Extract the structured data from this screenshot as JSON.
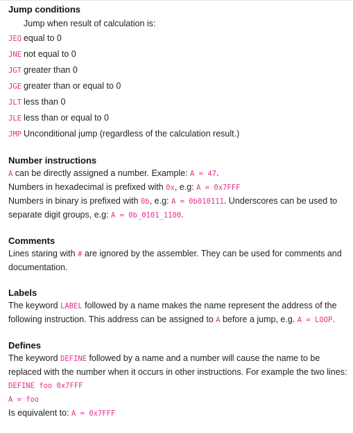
{
  "jump": {
    "title": "Jump conditions",
    "intro": "Jump when result of calculation is:",
    "conditions": [
      {
        "code": "JEQ",
        "desc": "equal to 0"
      },
      {
        "code": "JNE",
        "desc": "not equal to 0"
      },
      {
        "code": "JGT",
        "desc": "greater than 0"
      },
      {
        "code": "JGE",
        "desc": "greater than or equal to 0"
      },
      {
        "code": "JLT",
        "desc": "less than 0"
      },
      {
        "code": "JLE",
        "desc": "less than or equal to 0"
      },
      {
        "code": "JMP",
        "desc": "Unconditional jump (regardless of the calculation result.)"
      }
    ]
  },
  "number": {
    "title": "Number instructions",
    "l1_code1": "A",
    "l1_text1": " can be directly assigned a number. Example: ",
    "l1_code2": "A = 47",
    "l1_text2": ".",
    "l2_text1": "Numbers in hexadecimal is prefixed with ",
    "l2_code1": "0x",
    "l2_text2": ", e.g: ",
    "l2_code2": "A = 0x7FFF",
    "l3_text1": "Numbers in binary is prefixed with ",
    "l3_code1": "0b",
    "l3_text2": ", e.g: ",
    "l3_code2": "A = 0b010111",
    "l3_text3": ". Underscores can be used to separate digit groups, e.g: ",
    "l3_code3": "A = 0b_0101_1100",
    "l3_text4": "."
  },
  "comments": {
    "title": "Comments",
    "text1": "Lines staring with ",
    "code1": "#",
    "text2": " are ignored by the assembler. They can be used for comments and documentation."
  },
  "labels": {
    "title": "Labels",
    "text1": "The keyword ",
    "code1": "LABEL",
    "text2": " followed by a name makes the name represent the address of the following instruction. This address can be assigned to ",
    "code2": "A",
    "text3": " before a jump, e.g. ",
    "code3": "A = LOOP",
    "text4": "."
  },
  "defines": {
    "title": "Defines",
    "text1": "The keyword ",
    "code1": "DEFINE",
    "text2": " followed by a name and a number will cause the name to be replaced with the number when it occurs in other instructions. For example the two lines:",
    "example1": "DEFINE foo 0x7FFF",
    "example2": "A = foo",
    "equiv_text": "Is equivalent to: ",
    "equiv_code": "A = 0x7FFF"
  }
}
